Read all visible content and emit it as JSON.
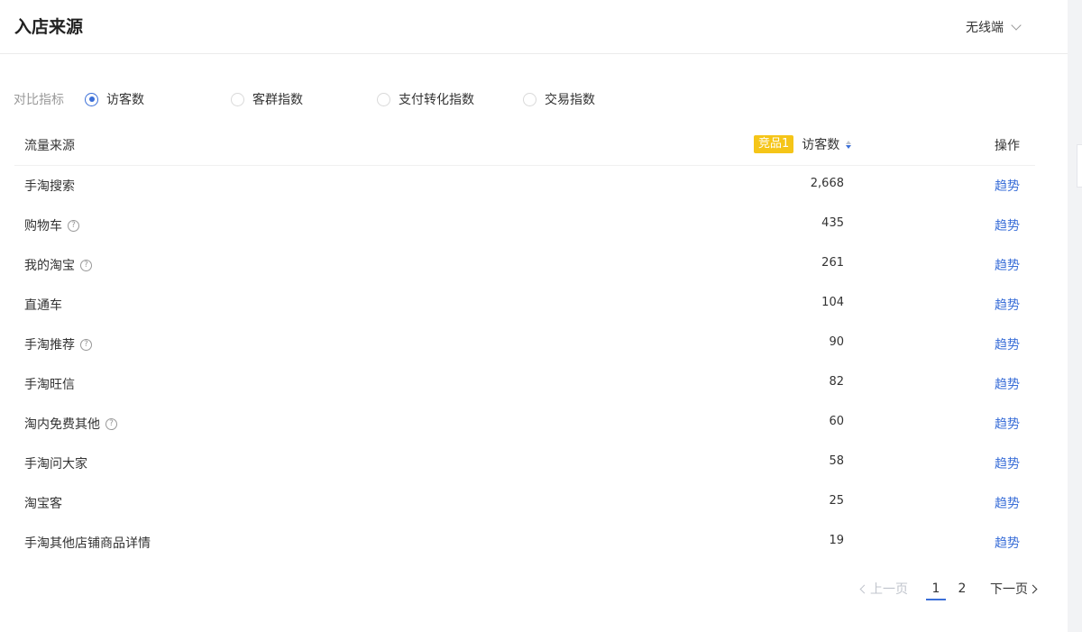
{
  "header": {
    "title": "入店来源",
    "device_select": "无线端"
  },
  "metrics": {
    "label": "对比指标",
    "options": [
      {
        "label": "访客数",
        "checked": true
      },
      {
        "label": "客群指数",
        "checked": false
      },
      {
        "label": "支付转化指数",
        "checked": false
      },
      {
        "label": "交易指数",
        "checked": false
      }
    ]
  },
  "table": {
    "col_source": "流量来源",
    "badge": "竞品1",
    "col_metric": "访客数",
    "col_op": "操作",
    "rows": [
      {
        "source": "手淘搜索",
        "help": false,
        "value": "2,668",
        "op": "趋势"
      },
      {
        "source": "购物车",
        "help": true,
        "value": "435",
        "op": "趋势"
      },
      {
        "source": "我的淘宝",
        "help": true,
        "value": "261",
        "op": "趋势"
      },
      {
        "source": "直通车",
        "help": false,
        "value": "104",
        "op": "趋势"
      },
      {
        "source": "手淘推荐",
        "help": true,
        "value": "90",
        "op": "趋势"
      },
      {
        "source": "手淘旺信",
        "help": false,
        "value": "82",
        "op": "趋势"
      },
      {
        "source": "淘内免费其他",
        "help": true,
        "value": "60",
        "op": "趋势"
      },
      {
        "source": "手淘问大家",
        "help": false,
        "value": "58",
        "op": "趋势"
      },
      {
        "source": "淘宝客",
        "help": false,
        "value": "25",
        "op": "趋势"
      },
      {
        "source": "手淘其他店铺商品详情",
        "help": false,
        "value": "19",
        "op": "趋势"
      }
    ]
  },
  "pager": {
    "prev": "上一页",
    "pages": [
      "1",
      "2"
    ],
    "current": "1",
    "next": "下一页"
  },
  "colors": {
    "accent": "#3b6fd8",
    "badge": "#f5c518"
  }
}
